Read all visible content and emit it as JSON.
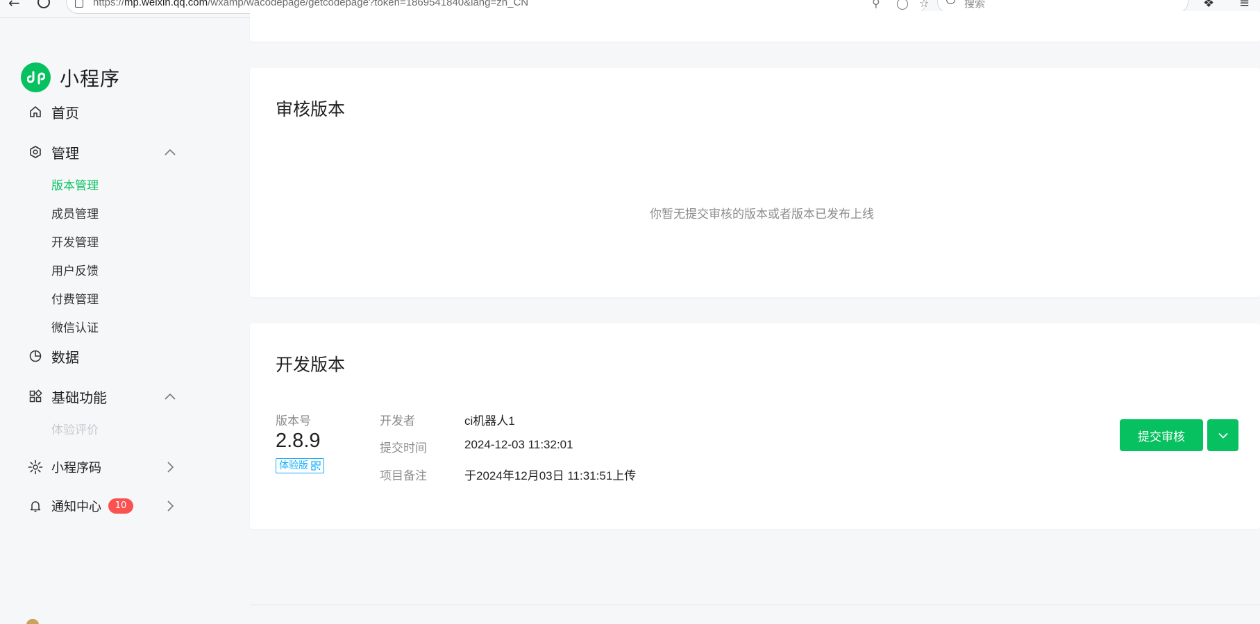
{
  "browser": {
    "url_prefix": "https://",
    "url_host": "mp.weixin.qq.com",
    "url_path": "/wxamp/wacodepage/getcodepage?token=1869541840&lang=zh_CN",
    "search_placeholder": "搜索"
  },
  "brand": {
    "name": "小程序",
    "color": "#07c160"
  },
  "sidebar": {
    "home": {
      "label": "首页",
      "icon": "home-icon"
    },
    "manage": {
      "label": "管理",
      "icon": "hexagon-gear-icon",
      "expanded": true,
      "children": [
        {
          "label": "版本管理",
          "active": true
        },
        {
          "label": "成员管理"
        },
        {
          "label": "开发管理"
        },
        {
          "label": "用户反馈"
        },
        {
          "label": "付费管理"
        },
        {
          "label": "微信认证"
        }
      ]
    },
    "data": {
      "label": "数据",
      "icon": "pie-chart-icon"
    },
    "basic": {
      "label": "基础功能",
      "icon": "grid-icon",
      "expanded": true,
      "children": [
        {
          "label": "体验评价",
          "faded": true
        }
      ]
    },
    "qrcode": {
      "label": "小程序码",
      "icon": "sun-code-icon"
    },
    "notify": {
      "label": "通知中心",
      "icon": "bell-icon",
      "badge": "10"
    }
  },
  "review": {
    "title": "审核版本",
    "empty_text": "你暂无提交审核的版本或者版本已发布上线"
  },
  "dev": {
    "title": "开发版本",
    "version_label": "版本号",
    "version_number": "2.8.9",
    "version_tag": "体验版",
    "rows": [
      {
        "key": "开发者",
        "value": "ci机器人1"
      },
      {
        "key": "提交时间",
        "value": "2024-12-03 11:32:01"
      },
      {
        "key": "项目备注",
        "value": "于2024年12月03日 11:31:51上传"
      }
    ],
    "submit_label": "提交审核"
  },
  "colors": {
    "accent": "#07c160",
    "badge": "#fa5151",
    "tag": "#10aeff",
    "muted": "#8c8c8c"
  }
}
